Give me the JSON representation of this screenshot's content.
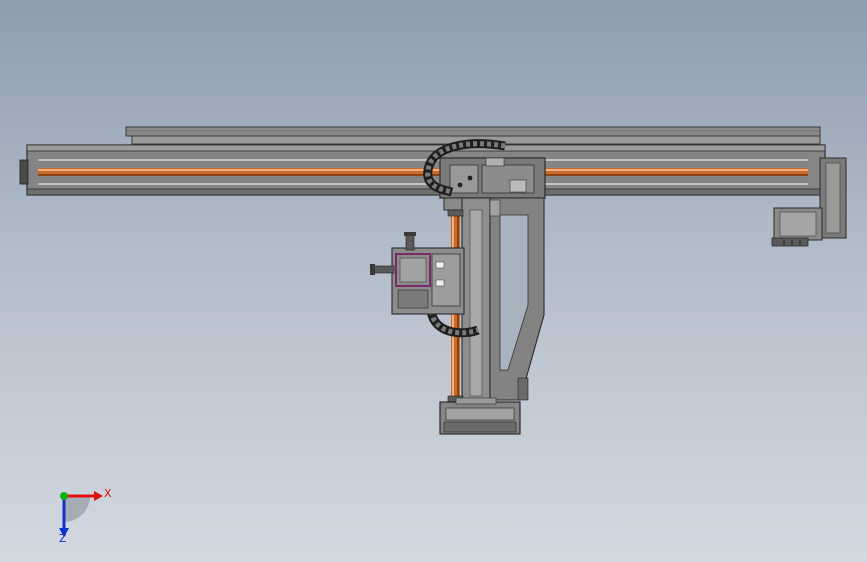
{
  "colors": {
    "background_top": "#8f9dae",
    "background_bottom": "#d3d9e1",
    "frame_gray": "#7d7d7d",
    "frame_dark": "#3a3a3a",
    "rod_copper": "#c86a2c",
    "rod_highlight": "#f0b080",
    "panel_purple": "#7a2a6a",
    "axis_x": "#e01010",
    "axis_y": "#10b010",
    "axis_z": "#1030d0"
  },
  "triad": {
    "x_label": "X",
    "z_label": "Z"
  }
}
